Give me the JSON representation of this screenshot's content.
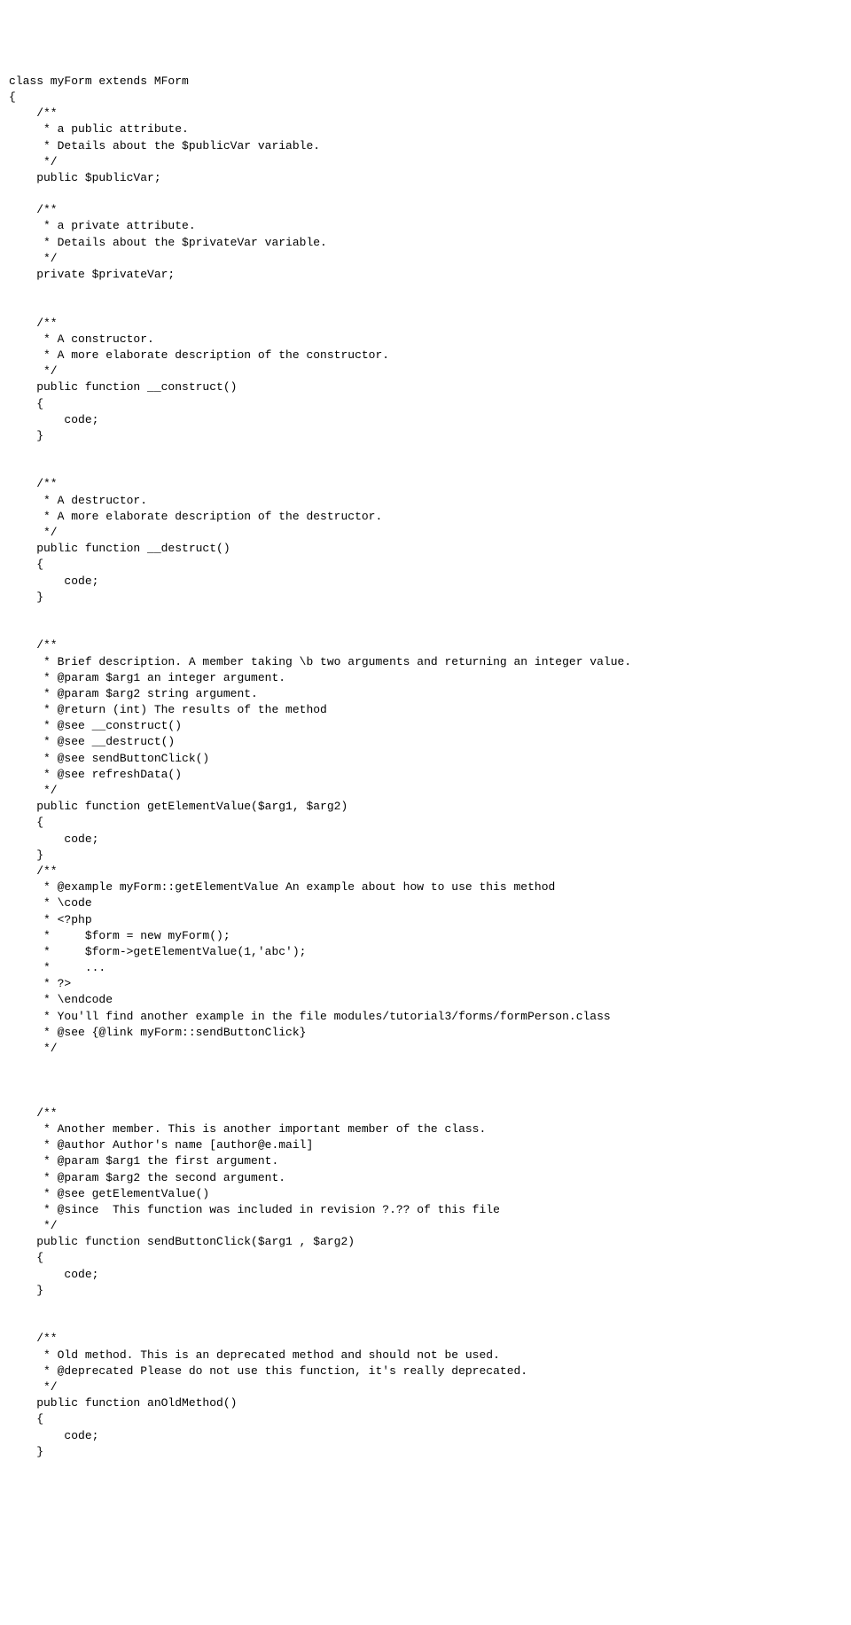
{
  "code": {
    "l01": "class myForm extends MForm",
    "l02": "{",
    "l03": "    /**",
    "l04": "     * a public attribute.",
    "l05": "     * Details about the $publicVar variable.",
    "l06": "     */",
    "l07": "    public $publicVar;",
    "l08": "",
    "l09": "    /**",
    "l10": "     * a private attribute.",
    "l11": "     * Details about the $privateVar variable.",
    "l12": "     */",
    "l13": "    private $privateVar;",
    "l14": "",
    "l15": "",
    "l16": "    /**",
    "l17": "     * A constructor.",
    "l18": "     * A more elaborate description of the constructor.",
    "l19": "     */",
    "l20": "    public function __construct()",
    "l21": "    {",
    "l22": "        code;",
    "l23": "    }",
    "l24": "",
    "l25": "",
    "l26": "    /**",
    "l27": "     * A destructor.",
    "l28": "     * A more elaborate description of the destructor.",
    "l29": "     */",
    "l30": "    public function __destruct()",
    "l31": "    {",
    "l32": "        code;",
    "l33": "    }",
    "l34": "",
    "l35": "",
    "l36": "    /**",
    "l37": "     * Brief description. A member taking \\b two arguments and returning an integer value.",
    "l38": "     * @param $arg1 an integer argument.",
    "l39": "     * @param $arg2 string argument.",
    "l40": "     * @return (int) The results of the method",
    "l41": "     * @see __construct()",
    "l42": "     * @see __destruct()",
    "l43": "     * @see sendButtonClick()",
    "l44": "     * @see refreshData()",
    "l45": "     */",
    "l46": "    public function getElementValue($arg1, $arg2)",
    "l47": "    {",
    "l48": "        code;",
    "l49": "    }",
    "l50": "    /**",
    "l51": "     * @example myForm::getElementValue An example about how to use this method",
    "l52": "     * \\code",
    "l53": "     * <?php",
    "l54": "     *     $form = new myForm();",
    "l55": "     *     $form->getElementValue(1,'abc');",
    "l56": "     *     ...",
    "l57": "     * ?>",
    "l58": "     * \\endcode",
    "l59": "     * You'll find another example in the file modules/tutorial3/forms/formPerson.class",
    "l60": "     * @see {@link myForm::sendButtonClick}",
    "l61": "     */",
    "l62": "",
    "l63": "",
    "l64": "",
    "l65": "    /**",
    "l66": "     * Another member. This is another important member of the class.",
    "l67": "     * @author Author's name [author@e.mail]",
    "l68": "     * @param $arg1 the first argument.",
    "l69": "     * @param $arg2 the second argument.",
    "l70": "     * @see getElementValue()",
    "l71": "     * @since  This function was included in revision ?.?? of this file",
    "l72": "     */",
    "l73": "    public function sendButtonClick($arg1 , $arg2)",
    "l74": "    {",
    "l75": "        code;",
    "l76": "    }",
    "l77": "",
    "l78": "",
    "l79": "    /**",
    "l80": "     * Old method. This is an deprecated method and should not be used.",
    "l81": "     * @deprecated Please do not use this function, it's really deprecated.",
    "l82": "     */",
    "l83": "    public function anOldMethod()",
    "l84": "    {",
    "l85": "        code;",
    "l86": "    }"
  }
}
